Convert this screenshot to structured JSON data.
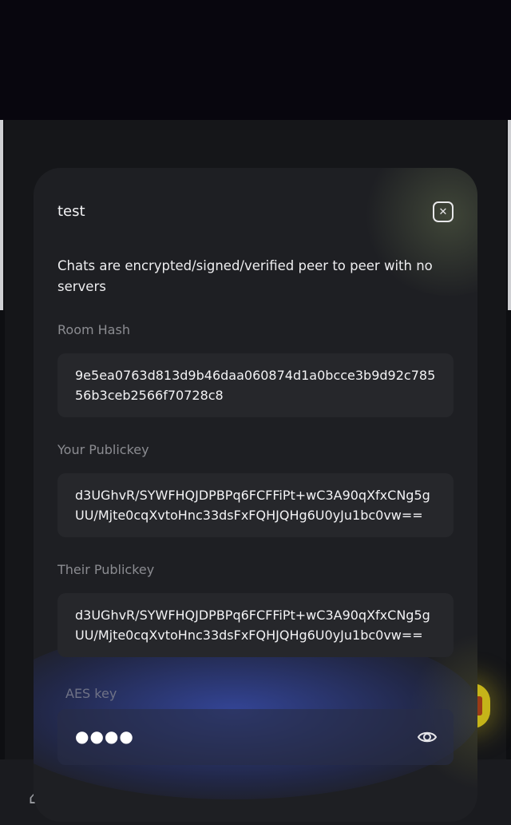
{
  "modal": {
    "title": "test",
    "description": "Chats are encrypted/signed/verified peer to peer with no servers",
    "room_hash": {
      "label": "Room Hash",
      "value": "9e5ea0763d813d9b46daa060874d1a0bcce3b9d92c78556b3ceb2566f70728c8"
    },
    "your_publickey": {
      "label": "Your Publickey",
      "value": "d3UGhvR/SYWFHQJDPBPq6FCFFiPt+wC3A90qXfxCNg5gUU/Mjte0cqXvtoHnc33dsFxFQHJQHg6U0yJu1bc0vw=="
    },
    "their_publickey": {
      "label": "Their Publickey",
      "value": "d3UGhvR/SYWFHQJDPBPq6FCFFiPt+wC3A90qXfxCNg5gUU/Mjte0cqXvtoHnc33dsFxFQHJQHg6U0yJu1bc0vw=="
    },
    "aes_key": {
      "label": "AES key",
      "masked_value": "●●●●"
    }
  },
  "icons": {
    "close": "close-icon",
    "eye": "eye-icon"
  },
  "colors": {
    "page_bg": "#07060d",
    "modal_bg": "#1e1f23",
    "field_bg": "#26272b",
    "label": "#8b8c91",
    "fab_accent": "#c5b419"
  }
}
